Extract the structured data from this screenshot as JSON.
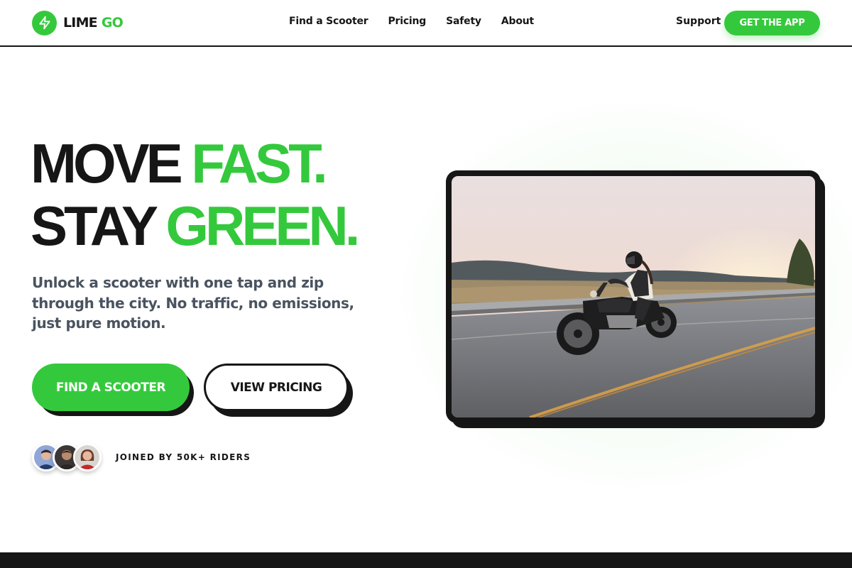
{
  "brand": {
    "name_part1": "LIME",
    "name_part2": "GO",
    "logo_icon": "lightning-bolt-icon",
    "accent_color": "#34c93c",
    "dark_color": "#161616"
  },
  "nav": {
    "links": [
      "Find a Scooter",
      "Pricing",
      "Safety",
      "About"
    ],
    "support_label": "Support",
    "cta_label": "GET THE APP"
  },
  "hero": {
    "headline_line1_dark": "MOVE",
    "headline_line1_green": "FAST.",
    "headline_line2_dark": "STAY",
    "headline_line2_green": "GREEN.",
    "subtitle": "Unlock a scooter with one tap and zip through the city. No traffic, no emissions, just pure motion.",
    "primary_button": "FIND A SCOOTER",
    "secondary_button": "VIEW PRICING",
    "social_proof": "JOINED BY 50K+ RIDERS"
  }
}
